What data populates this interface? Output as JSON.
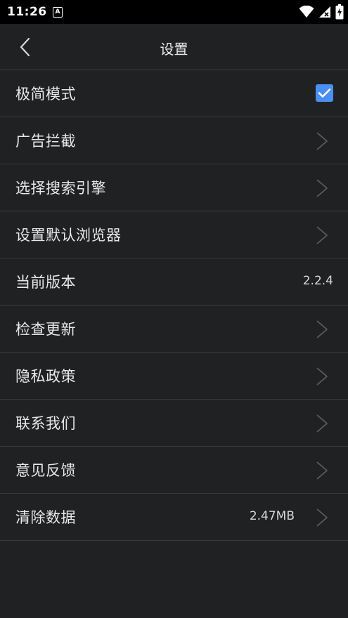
{
  "status_bar": {
    "time": "11:26",
    "notification_icon": "A",
    "icons": [
      "wifi-icon",
      "signal-icon",
      "battery-charging-icon"
    ]
  },
  "header": {
    "back_icon": "chevron-left-icon",
    "title": "设置"
  },
  "settings": {
    "items": [
      {
        "label": "极简模式",
        "control": "checkbox",
        "checked": true
      },
      {
        "label": "广告拦截",
        "control": "chevron"
      },
      {
        "label": "选择搜索引擎",
        "control": "chevron"
      },
      {
        "label": "设置默认浏览器",
        "control": "chevron"
      },
      {
        "label": "当前版本",
        "control": "value",
        "value": "2.2.4"
      },
      {
        "label": "检查更新",
        "control": "chevron"
      },
      {
        "label": "隐私政策",
        "control": "chevron"
      },
      {
        "label": "联系我们",
        "control": "chevron"
      },
      {
        "label": "意见反馈",
        "control": "chevron"
      },
      {
        "label": "清除数据",
        "control": "value+chevron",
        "value": "2.47MB"
      }
    ]
  },
  "colors": {
    "background": "#202123",
    "divider": "#3a3b3e",
    "accent": "#4a8ff2",
    "text": "#e8e8e8",
    "chevron": "#5a5b5f"
  }
}
